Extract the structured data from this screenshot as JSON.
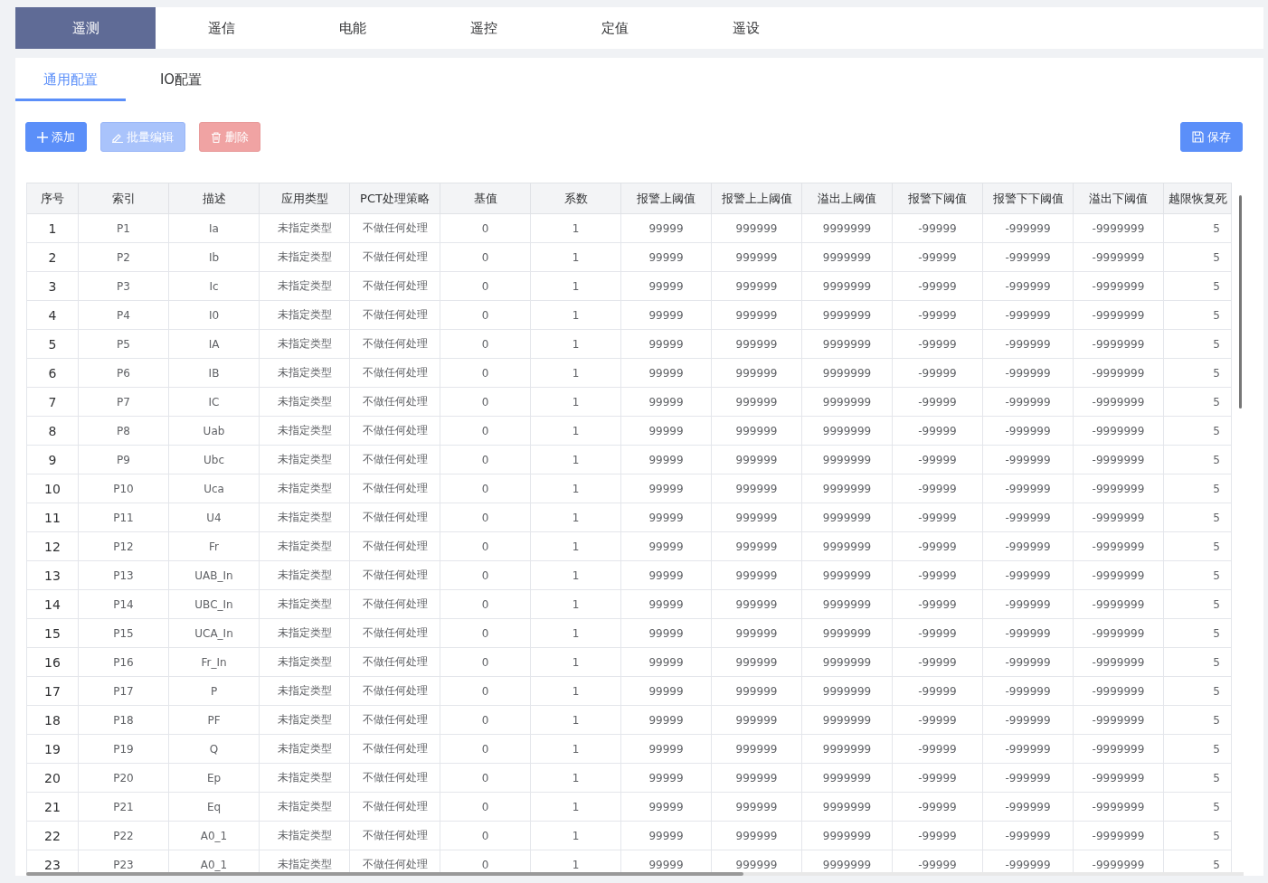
{
  "top_tabs": [
    {
      "label": "遥测",
      "selected": true
    },
    {
      "label": "遥信",
      "selected": false
    },
    {
      "label": "电能",
      "selected": false
    },
    {
      "label": "遥控",
      "selected": false
    },
    {
      "label": "定值",
      "selected": false
    },
    {
      "label": "遥设",
      "selected": false
    }
  ],
  "sub_tabs": [
    {
      "label": "通用配置",
      "selected": true
    },
    {
      "label": "IO配置",
      "selected": false
    }
  ],
  "toolbar": {
    "buttons": [
      {
        "kind": "add",
        "label": "添加",
        "disabled": false
      },
      {
        "kind": "edit",
        "label": "批量编辑",
        "disabled": true
      },
      {
        "kind": "delete",
        "label": "删除",
        "disabled": true
      }
    ],
    "save": {
      "label": "保存"
    }
  },
  "table": {
    "columns": [
      "序号",
      "索引",
      "描述",
      "应用类型",
      "PCT处理策略",
      "基值",
      "系数",
      "报警上阈值",
      "报警上上阈值",
      "溢出上阈值",
      "报警下阈值",
      "报警下下阈值",
      "溢出下阈值",
      "越限恢复死"
    ],
    "rows": [
      {
        "cells": [
          "1",
          "P1",
          "Ia",
          "未指定类型",
          "不做任何处理",
          "0",
          "1",
          "99999",
          "999999",
          "9999999",
          "-99999",
          "-999999",
          "-9999999",
          "5"
        ]
      },
      {
        "cells": [
          "2",
          "P2",
          "Ib",
          "未指定类型",
          "不做任何处理",
          "0",
          "1",
          "99999",
          "999999",
          "9999999",
          "-99999",
          "-999999",
          "-9999999",
          "5"
        ]
      },
      {
        "cells": [
          "3",
          "P3",
          "Ic",
          "未指定类型",
          "不做任何处理",
          "0",
          "1",
          "99999",
          "999999",
          "9999999",
          "-99999",
          "-999999",
          "-9999999",
          "5"
        ]
      },
      {
        "cells": [
          "4",
          "P4",
          "I0",
          "未指定类型",
          "不做任何处理",
          "0",
          "1",
          "99999",
          "999999",
          "9999999",
          "-99999",
          "-999999",
          "-9999999",
          "5"
        ]
      },
      {
        "cells": [
          "5",
          "P5",
          "IA",
          "未指定类型",
          "不做任何处理",
          "0",
          "1",
          "99999",
          "999999",
          "9999999",
          "-99999",
          "-999999",
          "-9999999",
          "5"
        ]
      },
      {
        "cells": [
          "6",
          "P6",
          "IB",
          "未指定类型",
          "不做任何处理",
          "0",
          "1",
          "99999",
          "999999",
          "9999999",
          "-99999",
          "-999999",
          "-9999999",
          "5"
        ]
      },
      {
        "cells": [
          "7",
          "P7",
          "IC",
          "未指定类型",
          "不做任何处理",
          "0",
          "1",
          "99999",
          "999999",
          "9999999",
          "-99999",
          "-999999",
          "-9999999",
          "5"
        ]
      },
      {
        "cells": [
          "8",
          "P8",
          "Uab",
          "未指定类型",
          "不做任何处理",
          "0",
          "1",
          "99999",
          "999999",
          "9999999",
          "-99999",
          "-999999",
          "-9999999",
          "5"
        ]
      },
      {
        "cells": [
          "9",
          "P9",
          "Ubc",
          "未指定类型",
          "不做任何处理",
          "0",
          "1",
          "99999",
          "999999",
          "9999999",
          "-99999",
          "-999999",
          "-9999999",
          "5"
        ]
      },
      {
        "cells": [
          "10",
          "P10",
          "Uca",
          "未指定类型",
          "不做任何处理",
          "0",
          "1",
          "99999",
          "999999",
          "9999999",
          "-99999",
          "-999999",
          "-9999999",
          "5"
        ]
      },
      {
        "cells": [
          "11",
          "P11",
          "U4",
          "未指定类型",
          "不做任何处理",
          "0",
          "1",
          "99999",
          "999999",
          "9999999",
          "-99999",
          "-999999",
          "-9999999",
          "5"
        ]
      },
      {
        "cells": [
          "12",
          "P12",
          "Fr",
          "未指定类型",
          "不做任何处理",
          "0",
          "1",
          "99999",
          "999999",
          "9999999",
          "-99999",
          "-999999",
          "-9999999",
          "5"
        ]
      },
      {
        "cells": [
          "13",
          "P13",
          "UAB_In",
          "未指定类型",
          "不做任何处理",
          "0",
          "1",
          "99999",
          "999999",
          "9999999",
          "-99999",
          "-999999",
          "-9999999",
          "5"
        ]
      },
      {
        "cells": [
          "14",
          "P14",
          "UBC_In",
          "未指定类型",
          "不做任何处理",
          "0",
          "1",
          "99999",
          "999999",
          "9999999",
          "-99999",
          "-999999",
          "-9999999",
          "5"
        ]
      },
      {
        "cells": [
          "15",
          "P15",
          "UCA_In",
          "未指定类型",
          "不做任何处理",
          "0",
          "1",
          "99999",
          "999999",
          "9999999",
          "-99999",
          "-999999",
          "-9999999",
          "5"
        ]
      },
      {
        "cells": [
          "16",
          "P16",
          "Fr_In",
          "未指定类型",
          "不做任何处理",
          "0",
          "1",
          "99999",
          "999999",
          "9999999",
          "-99999",
          "-999999",
          "-9999999",
          "5"
        ]
      },
      {
        "cells": [
          "17",
          "P17",
          "P",
          "未指定类型",
          "不做任何处理",
          "0",
          "1",
          "99999",
          "999999",
          "9999999",
          "-99999",
          "-999999",
          "-9999999",
          "5"
        ]
      },
      {
        "cells": [
          "18",
          "P18",
          "PF",
          "未指定类型",
          "不做任何处理",
          "0",
          "1",
          "99999",
          "999999",
          "9999999",
          "-99999",
          "-999999",
          "-9999999",
          "5"
        ]
      },
      {
        "cells": [
          "19",
          "P19",
          "Q",
          "未指定类型",
          "不做任何处理",
          "0",
          "1",
          "99999",
          "999999",
          "9999999",
          "-99999",
          "-999999",
          "-9999999",
          "5"
        ]
      },
      {
        "cells": [
          "20",
          "P20",
          "Ep",
          "未指定类型",
          "不做任何处理",
          "0",
          "1",
          "99999",
          "999999",
          "9999999",
          "-99999",
          "-999999",
          "-9999999",
          "5"
        ]
      },
      {
        "cells": [
          "21",
          "P21",
          "Eq",
          "未指定类型",
          "不做任何处理",
          "0",
          "1",
          "99999",
          "999999",
          "9999999",
          "-99999",
          "-999999",
          "-9999999",
          "5"
        ]
      },
      {
        "cells": [
          "22",
          "P22",
          "A0_1",
          "未指定类型",
          "不做任何处理",
          "0",
          "1",
          "99999",
          "999999",
          "9999999",
          "-99999",
          "-999999",
          "-9999999",
          "5"
        ]
      },
      {
        "cells": [
          "23",
          "P23",
          "A0_1",
          "未指定类型",
          "不做任何处理",
          "0",
          "1",
          "99999",
          "999999",
          "9999999",
          "-99999",
          "-999999",
          "-9999999",
          "5"
        ]
      }
    ]
  }
}
